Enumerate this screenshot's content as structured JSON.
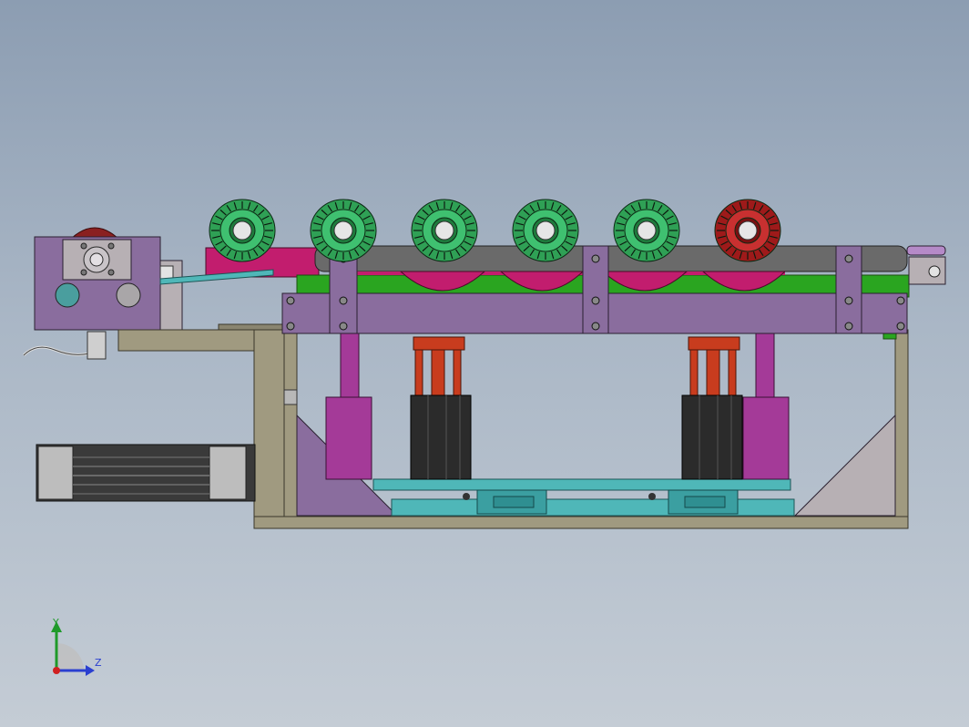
{
  "triad": {
    "y_label": "Y",
    "z_label": "Z"
  },
  "colors": {
    "background_top": "#8c9db2",
    "background_bottom": "#c4ccd5",
    "frame": "#a09a80",
    "plate_purple": "#8a6d9e",
    "gripper_magenta": "#a43a98",
    "cylinder_red": "#c83c1e",
    "motor_black": "#2b2b2b",
    "roller_green": "#2fa055",
    "roller_red": "#9e1a1a",
    "belt_grey": "#6a6a6a",
    "guide_green": "#2aa520",
    "rail_teal": "#4fb7b8",
    "mount_grey": "#b7b0b4"
  },
  "parts": {
    "rollers": [
      {
        "color": "green"
      },
      {
        "color": "green"
      },
      {
        "color": "green"
      },
      {
        "color": "green"
      },
      {
        "color": "green"
      },
      {
        "color": "red"
      }
    ]
  }
}
